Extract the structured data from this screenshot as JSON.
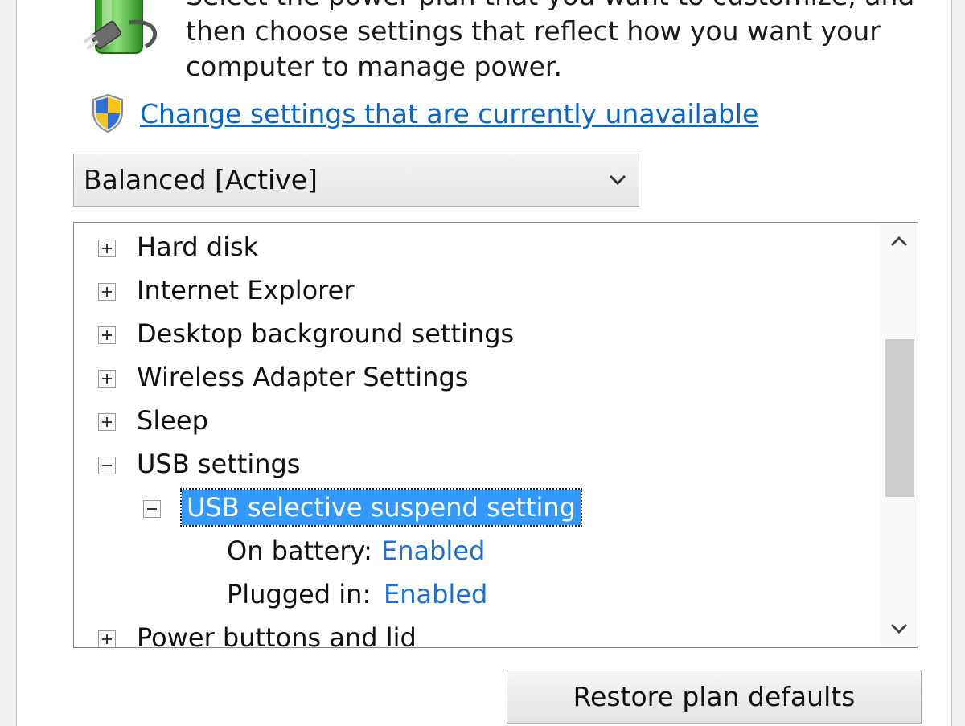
{
  "intro": {
    "line1": "Select the power plan that you want to customize, and",
    "line2": "then choose settings that reflect how you want your",
    "line3": "computer to manage power."
  },
  "change_link": "Change settings that are currently unavailable",
  "plan_select": {
    "value": "Balanced [Active]"
  },
  "tree": {
    "items": [
      {
        "label": "Hard disk",
        "expander": "plus"
      },
      {
        "label": "Internet Explorer",
        "expander": "plus"
      },
      {
        "label": "Desktop background settings",
        "expander": "plus"
      },
      {
        "label": "Wireless Adapter Settings",
        "expander": "plus"
      },
      {
        "label": "Sleep",
        "expander": "plus"
      },
      {
        "label": "USB settings",
        "expander": "minus"
      },
      {
        "label": "USB selective suspend setting",
        "expander": "minus",
        "selected": true
      },
      {
        "label": "On battery:",
        "value": "Enabled"
      },
      {
        "label": "Plugged in:",
        "value": "Enabled"
      },
      {
        "label": "Power buttons and lid",
        "expander": "plus"
      }
    ]
  },
  "buttons": {
    "restore": "Restore plan defaults"
  },
  "colors": {
    "link": "#0a66cc",
    "selection": "#3399ff",
    "battery_green": "#3fb62f"
  },
  "icons": [
    "battery-plug-icon",
    "uac-shield-icon",
    "chevron-down-icon",
    "scroll-up-icon",
    "scroll-down-icon"
  ]
}
